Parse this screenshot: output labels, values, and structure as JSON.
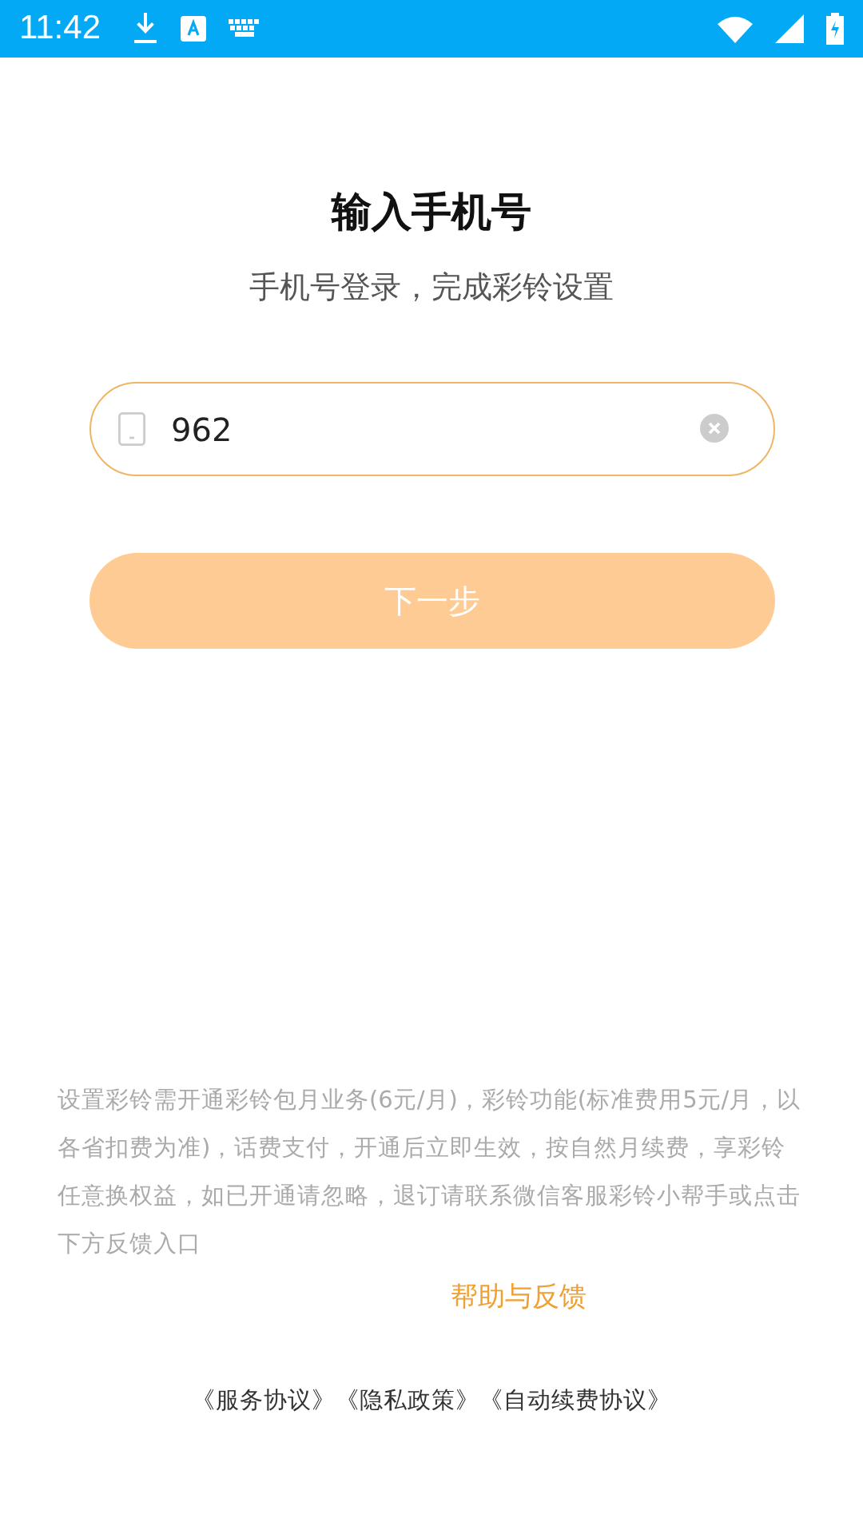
{
  "status_bar": {
    "time": "11:42"
  },
  "title": "输入手机号",
  "subtitle": "手机号登录，完成彩铃设置",
  "phone_field": {
    "value": "962"
  },
  "next_button": {
    "label": "下一步",
    "disabled": true
  },
  "notice": "设置彩铃需开通彩铃包月业务(6元/月)，彩铃功能(标准费用5元/月，以各省扣费为准)，话费支付，开通后立即生效，按自然月续费，享彩铃任意换权益，如已开通请忽略，退订请联系微信客服彩铃小帮手或点击下方反馈入口",
  "help_link": "帮助与反馈",
  "agreements": [
    "《服务协议》",
    "《隐私政策》",
    "《自动续费协议》"
  ]
}
